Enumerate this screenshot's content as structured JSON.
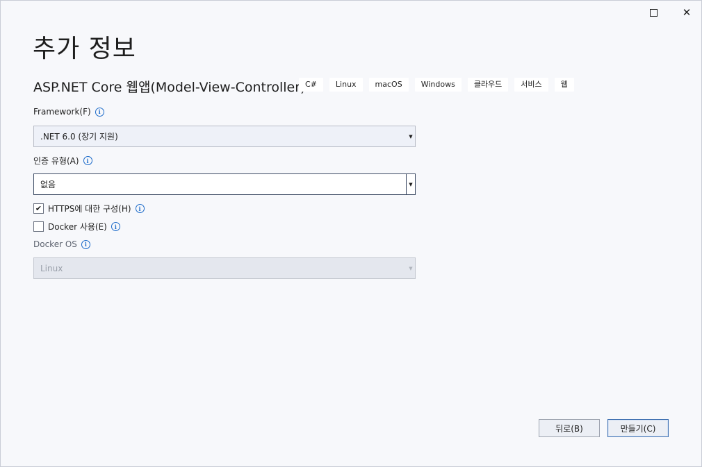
{
  "window": {
    "maximize_icon": "maximize-icon",
    "close_icon": "close-icon",
    "close_glyph": "✕"
  },
  "page": {
    "title": "추가 정보",
    "template_name": "ASP.NET Core 웹앱(Model-View-Controller)",
    "tags": [
      "C#",
      "Linux",
      "macOS",
      "Windows",
      "클라우드",
      "서비스",
      "웹"
    ]
  },
  "framework": {
    "label": "Framework(F)",
    "value": ".NET 6.0 (장기 지원)",
    "info_glyph": "i"
  },
  "auth": {
    "label": "인증 유형(A)",
    "value": "없음",
    "info_glyph": "i"
  },
  "https": {
    "label": "HTTPS에 대한 구성(H)",
    "checked": true,
    "check_glyph": "✔",
    "info_glyph": "i"
  },
  "docker": {
    "label": "Docker 사용(E)",
    "checked": false,
    "info_glyph": "i"
  },
  "docker_os": {
    "label": "Docker OS",
    "value": "Linux",
    "disabled": true,
    "info_glyph": "i"
  },
  "dropdown_arrow": "▼",
  "buttons": {
    "back": "뒤로(B)",
    "create": "만들기(C)"
  },
  "colors": {
    "background": "#f7f8fb",
    "accent": "#1b6ac9"
  }
}
